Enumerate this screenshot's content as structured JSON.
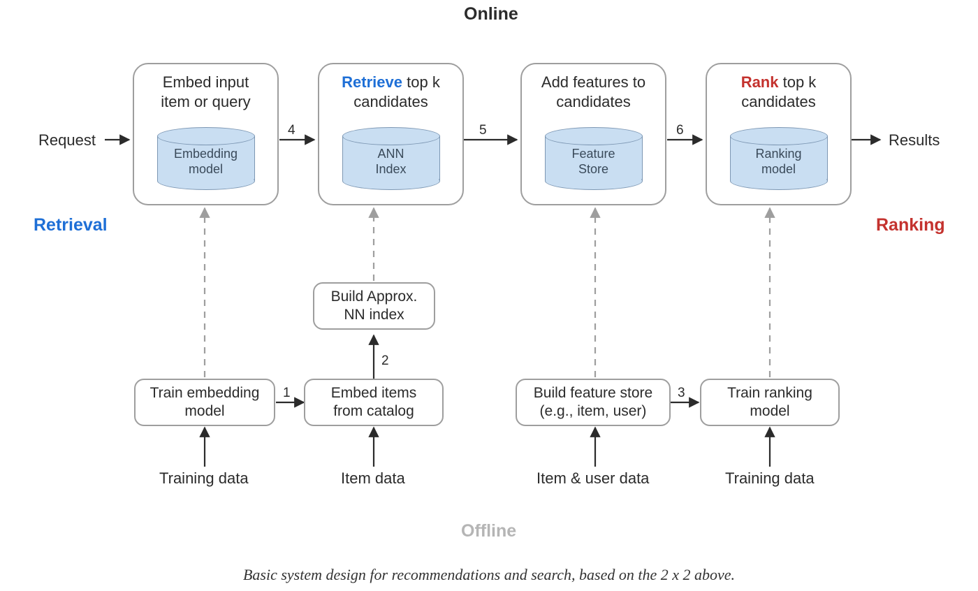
{
  "quadrants": {
    "online": "Online",
    "offline": "Offline",
    "retrieval": "Retrieval",
    "ranking": "Ranking"
  },
  "io": {
    "request": "Request",
    "results": "Results"
  },
  "online_boxes": {
    "embed_input": {
      "prefix": "",
      "accent": "",
      "line1": "Embed input",
      "line2": "item or query",
      "db": "Embedding\nmodel"
    },
    "retrieve": {
      "accent": "Retrieve",
      "rest": " top k",
      "line2": "candidates",
      "db": "ANN\nIndex"
    },
    "add_features": {
      "line1": "Add features to",
      "line2": "candidates",
      "db": "Feature\nStore"
    },
    "rank": {
      "accent": "Rank",
      "rest": " top k",
      "line2": "candidates",
      "db": "Ranking\nmodel"
    }
  },
  "offline_boxes": {
    "train_embedding": "Train embedding\nmodel",
    "embed_items": "Embed items\nfrom catalog",
    "build_ann": "Build Approx.\nNN index",
    "build_feature_store": "Build feature store\n(e.g., item, user)",
    "train_ranking": "Train ranking\nmodel"
  },
  "data_sources": {
    "training_data_left": "Training data",
    "item_data": "Item data",
    "item_user_data": "Item & user data",
    "training_data_right": "Training data"
  },
  "steps": {
    "s1": "1",
    "s2": "2",
    "s3": "3",
    "s4": "4",
    "s5": "5",
    "s6": "6"
  },
  "caption": "Basic system design for recommendations and search, based on the 2 x 2 above.",
  "colors": {
    "blue": "#1e6fd6",
    "red": "#c4322e",
    "axis_dark": "#2b2b2b",
    "axis_light": "#bfbfbf",
    "grey": "#9e9e9e"
  }
}
